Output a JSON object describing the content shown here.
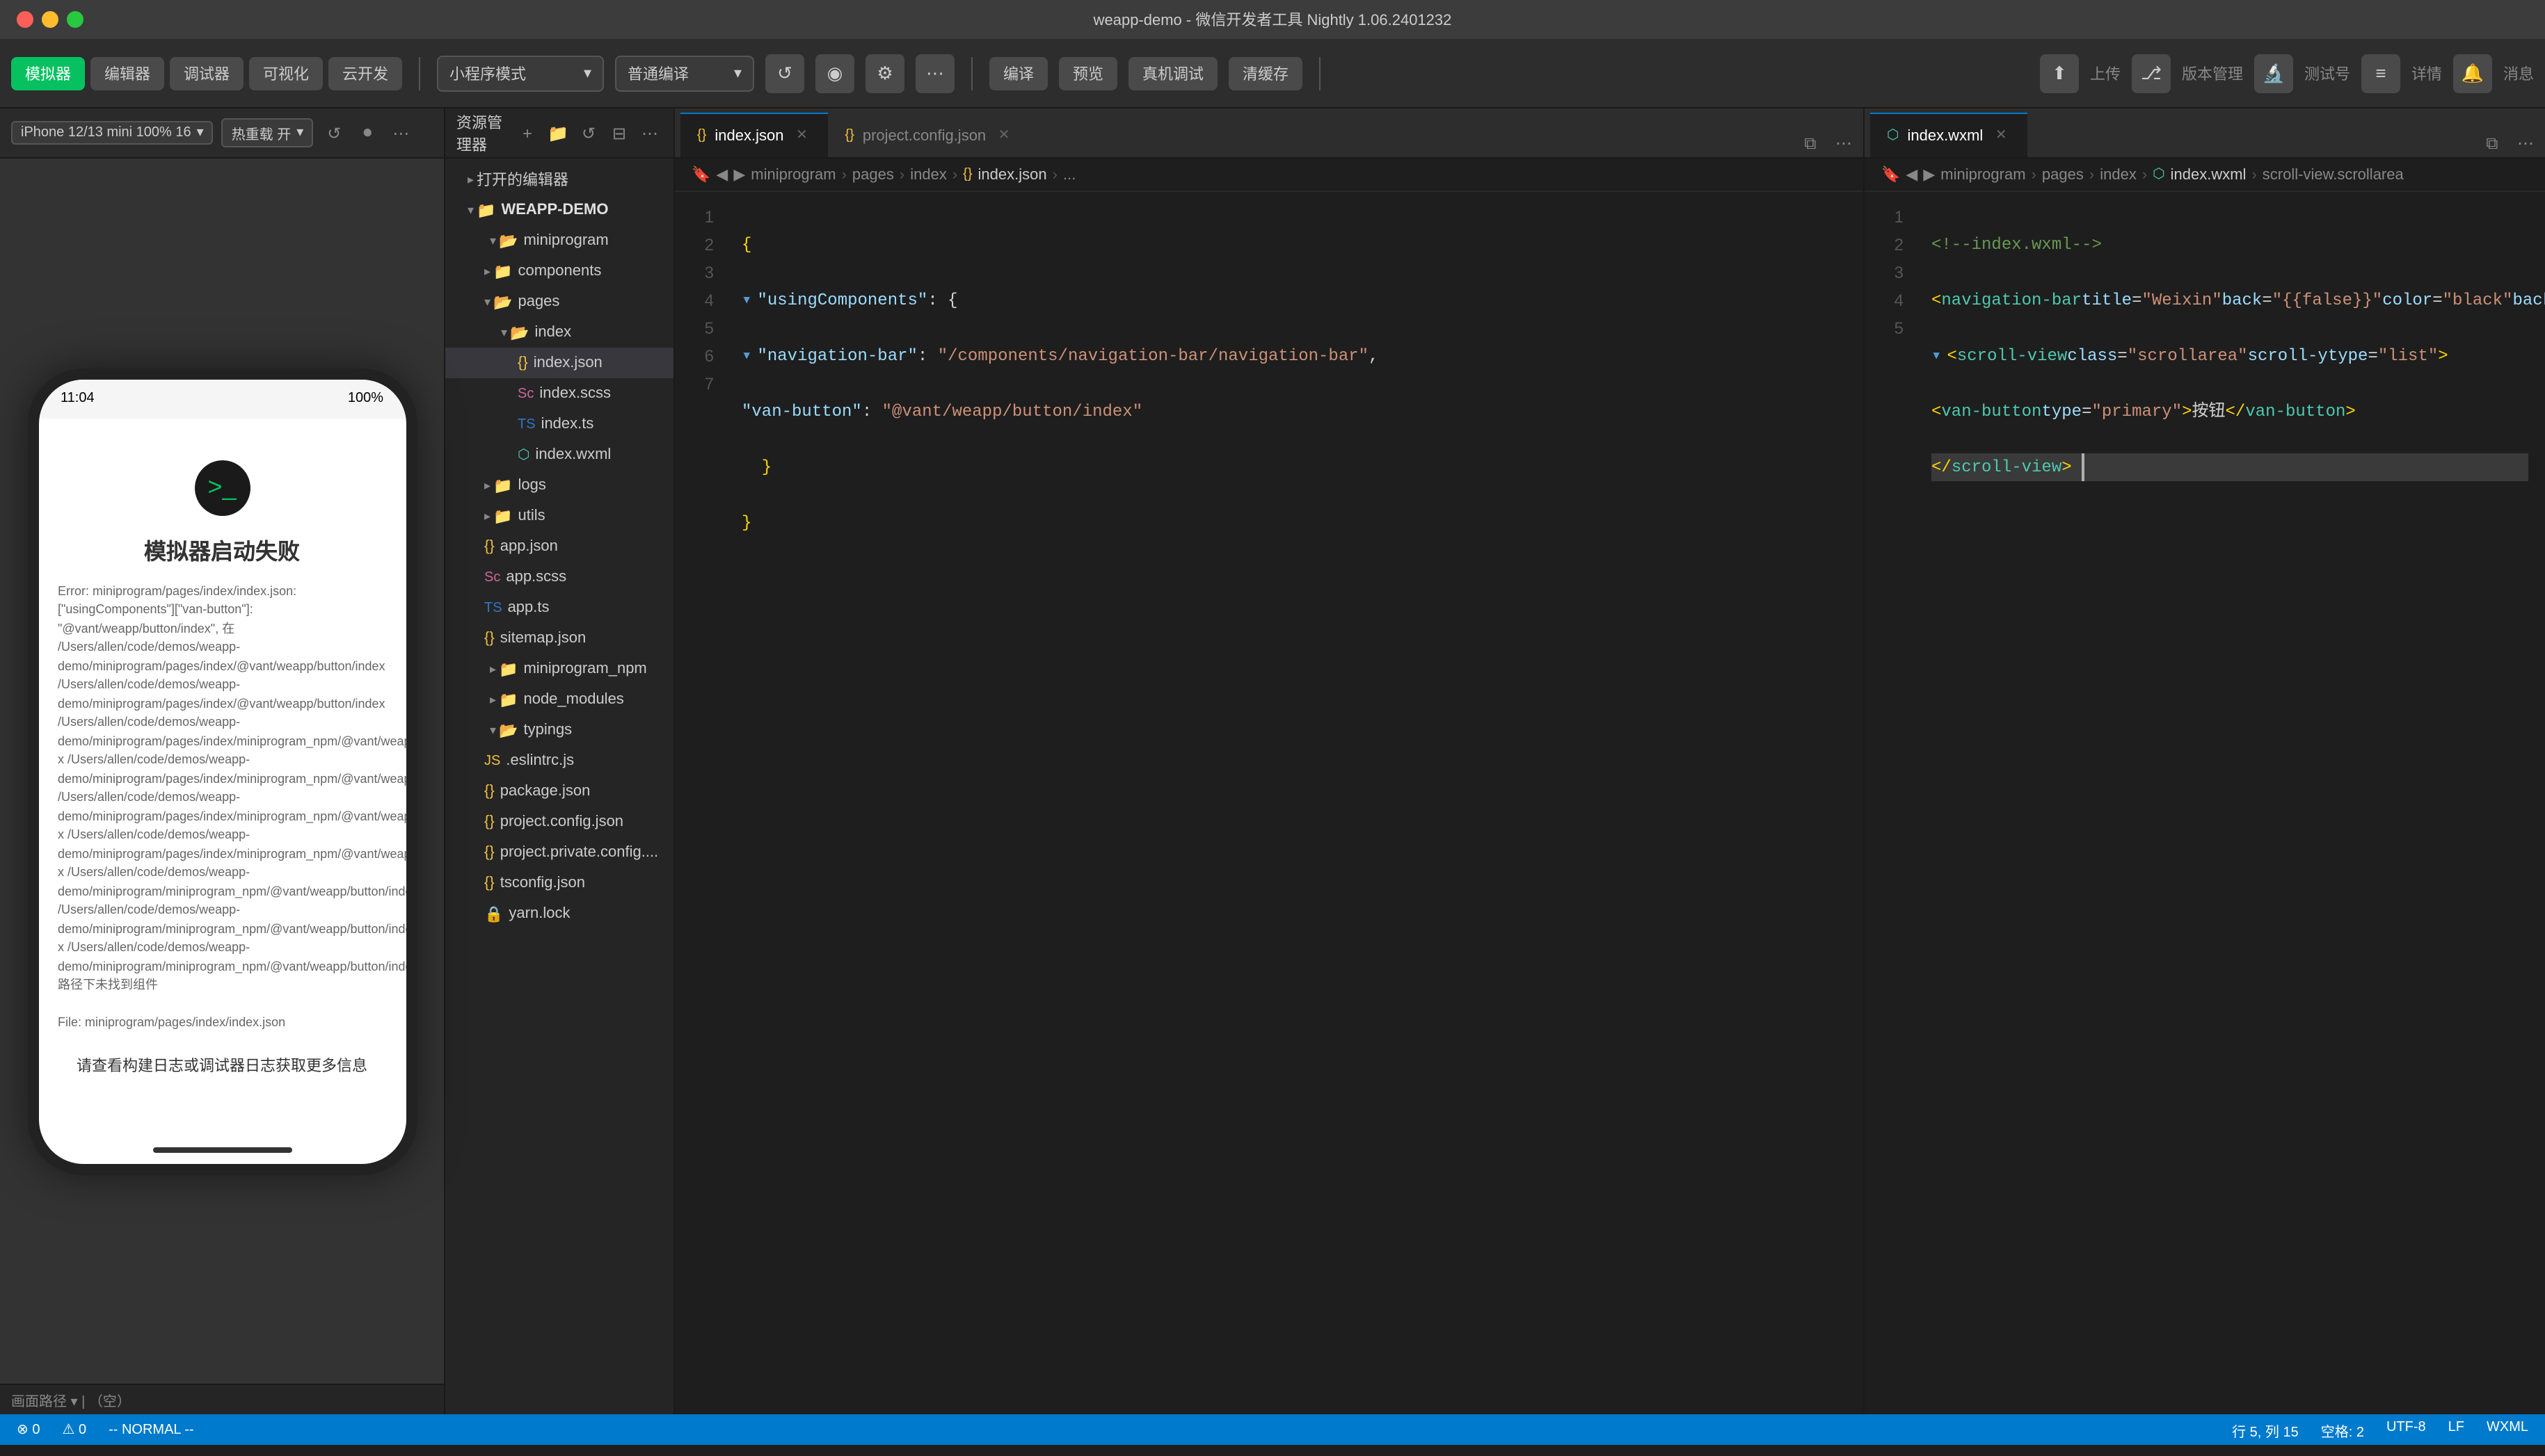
{
  "window": {
    "title": "weapp-demo - 微信开发者工具 Nightly 1.06.2401232"
  },
  "toolbar": {
    "simulator_label": "模拟器",
    "editor_label": "编辑器",
    "debugger_label": "调试器",
    "visualize_label": "可视化",
    "cloud_label": "云开发",
    "mini_mode_label": "小程序模式",
    "mini_mode_dropdown": "▾",
    "compile_label": "普通编译",
    "compile_dropdown": "▾",
    "refresh_btn": "↺",
    "preview_btn": "◉",
    "settings_btn": "⚙",
    "more_btn": "⋯",
    "compile_btn": "编译",
    "preview_btn2": "预览",
    "real_machine_label": "真机调试",
    "clear_cache_label": "清缓存",
    "upload_label": "上传",
    "version_label": "版本管理",
    "test_label": "测试号",
    "detail_label": "详情",
    "message_label": "消息"
  },
  "simulator": {
    "device": "iPhone 12/13 mini 100% 16",
    "hotreload": "热重载 开",
    "time": "11:04",
    "battery": "100%",
    "title": "模拟器启动失败",
    "error_text": "Error: miniprogram/pages/index/index.json: [\"usingComponents\"][\"van-button\"]: \"@vant/weapp/button/index\", 在 /Users/allen/code/demos/weapp-demo/miniprogram/pages/index/@vant/weapp/button/index /Users/allen/code/demos/weapp-demo/miniprogram/pages/index/@vant/weapp/button/index /Users/allen/code/demos/weapp-demo/miniprogram/pages/index/miniprogram_npm/@vant/weapp/button/index x /Users/allen/code/demos/weapp-demo/miniprogram/pages/index/miniprogram_npm/@vant/weapp/button/index /Users/allen/code/demos/weapp-demo/miniprogram/pages/index/miniprogram_npm/@vant/weapp/button/index x /Users/allen/code/demos/weapp-demo/miniprogram/pages/index/miniprogram_npm/@vant/weapp/button/index/index x /Users/allen/code/demos/weapp-demo/miniprogram/miniprogram_npm/@vant/weapp/button/index /Users/allen/code/demos/weapp-demo/miniprogram/miniprogram_npm/@vant/weapp/button/index x /Users/allen/code/demos/weapp-demo/miniprogram/miniprogram_npm/@vant/weapp/button/index/index 路径下未找到组件",
    "file_label": "File: miniprogram/pages/index/index.json",
    "hint": "请查看构建日志或调试器日志获取更多信息"
  },
  "file_explorer": {
    "title": "资源管理器",
    "opened_section": "打开的编辑器",
    "project_name": "WEAPP-DEMO",
    "items": [
      {
        "label": "miniprogram",
        "type": "folder",
        "indent": 1,
        "expanded": true
      },
      {
        "label": "components",
        "type": "folder",
        "indent": 2,
        "expanded": false
      },
      {
        "label": "pages",
        "type": "folder",
        "indent": 2,
        "expanded": true
      },
      {
        "label": "index",
        "type": "folder",
        "indent": 3,
        "expanded": true
      },
      {
        "label": "index.json",
        "type": "json",
        "indent": 4,
        "active": true
      },
      {
        "label": "index.scss",
        "type": "scss",
        "indent": 4
      },
      {
        "label": "index.ts",
        "type": "ts",
        "indent": 4
      },
      {
        "label": "index.wxml",
        "type": "wxml",
        "indent": 4
      },
      {
        "label": "logs",
        "type": "folder",
        "indent": 2
      },
      {
        "label": "utils",
        "type": "folder",
        "indent": 2,
        "expanded": false
      },
      {
        "label": "app.json",
        "type": "json",
        "indent": 2
      },
      {
        "label": "app.scss",
        "type": "scss",
        "indent": 2
      },
      {
        "label": "app.ts",
        "type": "ts",
        "indent": 2
      },
      {
        "label": "sitemap.json",
        "type": "json",
        "indent": 2
      },
      {
        "label": "miniprogram_npm",
        "type": "folder-blue",
        "indent": 1,
        "expanded": false
      },
      {
        "label": "node_modules",
        "type": "folder-blue",
        "indent": 1,
        "expanded": false
      },
      {
        "label": "typings",
        "type": "folder",
        "indent": 1,
        "expanded": false
      },
      {
        "label": ".eslintrc.js",
        "type": "js",
        "indent": 2
      },
      {
        "label": "package.json",
        "type": "json",
        "indent": 2
      },
      {
        "label": "project.config.json",
        "type": "json",
        "indent": 2
      },
      {
        "label": "project.private.config....",
        "type": "json",
        "indent": 2
      },
      {
        "label": "tsconfig.json",
        "type": "json",
        "indent": 2
      },
      {
        "label": "yarn.lock",
        "type": "lock",
        "indent": 2
      }
    ]
  },
  "editor_left": {
    "tabs": [
      {
        "label": "index.json",
        "type": "json",
        "active": true
      },
      {
        "label": "project.config.json",
        "type": "json"
      }
    ],
    "breadcrumb": [
      "miniprogram",
      "pages",
      "index",
      "index.json",
      "..."
    ],
    "lines": [
      {
        "num": 1,
        "content": "{"
      },
      {
        "num": 2,
        "content": "  \"usingComponents\": {"
      },
      {
        "num": 3,
        "content": "    \"navigation-bar\": \"/components/navigation-bar/navigation-bar\","
      },
      {
        "num": 4,
        "content": "    \"van-button\": \"@vant/weapp/button/index\""
      },
      {
        "num": 5,
        "content": "  }"
      },
      {
        "num": 6,
        "content": "}"
      },
      {
        "num": 7,
        "content": ""
      }
    ]
  },
  "editor_right": {
    "tabs": [
      {
        "label": "index.wxml",
        "type": "wxml",
        "active": true
      }
    ],
    "breadcrumb": [
      "miniprogram",
      "pages",
      "index",
      "index.wxml",
      "scroll-view.scrollarea"
    ],
    "lines": [
      {
        "num": 1,
        "content": "<!--index.wxml-->"
      },
      {
        "num": 2,
        "content": "<navigation-bar title=\"Weixin\" back=\"{{false}}\" color=\"black\" background=\"#FFF\"></navigation-bar>"
      },
      {
        "num": 3,
        "content": "<scroll-view class=\"scrollarea\" scroll-y type=\"list\">"
      },
      {
        "num": 4,
        "content": "  <van-button type=\"primary\">按钮</van-button>"
      },
      {
        "num": 5,
        "content": "</scroll-view>"
      }
    ]
  },
  "status_bar": {
    "errors": "0",
    "warnings": "0",
    "mode": "-- NORMAL --",
    "line": "行 5, 列 15",
    "spaces": "空格: 2",
    "encoding": "UTF-8",
    "eol": "LF",
    "lang": "WXML"
  }
}
